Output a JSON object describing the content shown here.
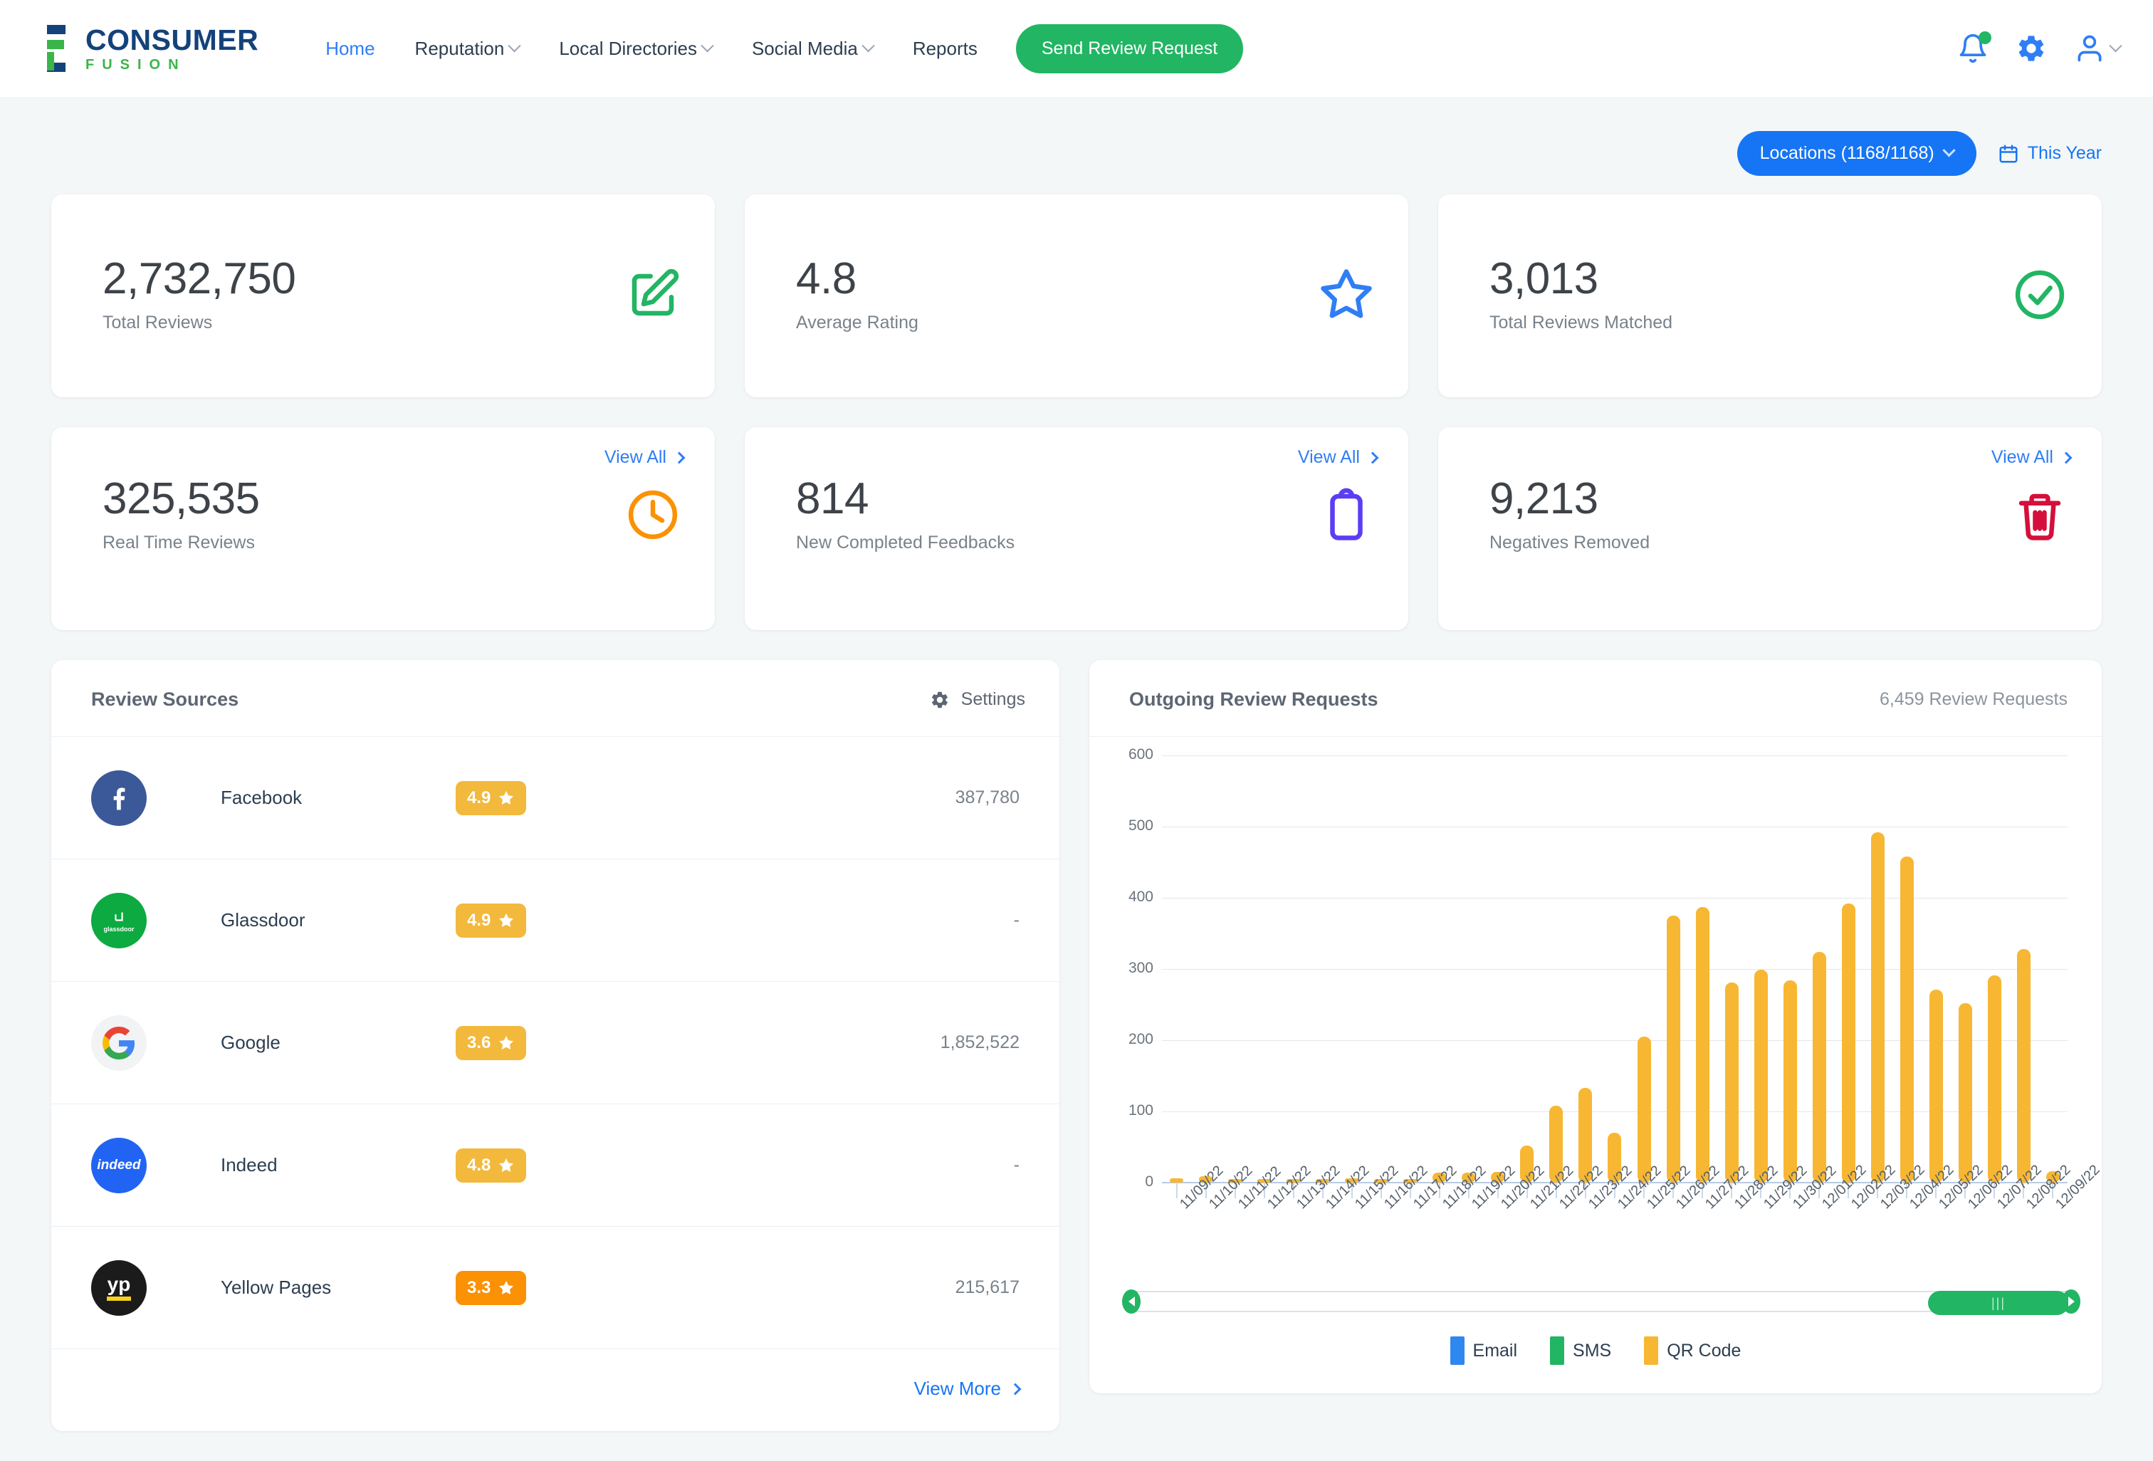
{
  "brand": {
    "name_top": "CONSUMER",
    "name_bottom": "FUSION"
  },
  "nav": {
    "items": [
      {
        "label": "Home",
        "has_caret": false,
        "active": true
      },
      {
        "label": "Reputation",
        "has_caret": true,
        "active": false
      },
      {
        "label": "Local Directories",
        "has_caret": true,
        "active": false
      },
      {
        "label": "Social Media",
        "has_caret": true,
        "active": false
      },
      {
        "label": "Reports",
        "has_caret": false,
        "active": false
      }
    ],
    "cta_label": "Send Review Request"
  },
  "filters": {
    "locations_label": "Locations (1168/1168)",
    "date_label": "This Year"
  },
  "stats_row1": [
    {
      "value": "2,732,750",
      "label": "Total Reviews",
      "icon": "edit-square-icon",
      "color": "#22b563"
    },
    {
      "value": "4.8",
      "label": "Average Rating",
      "icon": "star-outline-icon",
      "color": "#2f7ef5"
    },
    {
      "value": "3,013",
      "label": "Total Reviews Matched",
      "icon": "check-circle-icon",
      "color": "#22b563"
    }
  ],
  "stats_row2": [
    {
      "value": "325,535",
      "label": "Real Time Reviews",
      "icon": "clock-icon",
      "color": "#fb9104",
      "link": "View All"
    },
    {
      "value": "814",
      "label": "New Completed Feedbacks",
      "icon": "clipboard-icon",
      "color": "#5b3df5",
      "link": "View All"
    },
    {
      "value": "9,213",
      "label": "Negatives Removed",
      "icon": "trash-icon",
      "color": "#d50f3c",
      "link": "View All"
    }
  ],
  "review_sources": {
    "title": "Review Sources",
    "settings_label": "Settings",
    "view_more_label": "View More",
    "rows": [
      {
        "name": "Facebook",
        "rating": "4.9",
        "count": "387,780",
        "logo": "facebook-logo",
        "pill_color": "#f2b93c"
      },
      {
        "name": "Glassdoor",
        "rating": "4.9",
        "count": "-",
        "logo": "glassdoor-logo",
        "pill_color": "#f2b93c"
      },
      {
        "name": "Google",
        "rating": "3.6",
        "count": "1,852,522",
        "logo": "google-logo",
        "pill_color": "#f2b93c"
      },
      {
        "name": "Indeed",
        "rating": "4.8",
        "count": "-",
        "logo": "indeed-logo",
        "pill_color": "#f2b93c"
      },
      {
        "name": "Yellow Pages",
        "rating": "3.3",
        "count": "215,617",
        "logo": "yellowpages-logo",
        "pill_color": "#fb9104"
      }
    ]
  },
  "outgoing": {
    "title": "Outgoing Review Requests",
    "summary": "6,459 Review Requests",
    "legend": [
      {
        "label": "Email",
        "color": "#2f88f0"
      },
      {
        "label": "SMS",
        "color": "#22b563"
      },
      {
        "label": "QR Code",
        "color": "#f7b733"
      }
    ]
  },
  "chart_data": {
    "type": "bar",
    "title": "Outgoing Review Requests",
    "xlabel": "",
    "ylabel": "",
    "ylim": [
      0,
      600
    ],
    "yticks": [
      0,
      100,
      200,
      300,
      400,
      500,
      600
    ],
    "grid": true,
    "legend_position": "bottom",
    "categories": [
      "11/09/22",
      "11/10/22",
      "11/11/22",
      "11/12/22",
      "11/13/22",
      "11/14/22",
      "11/15/22",
      "11/16/22",
      "11/17/22",
      "11/18/22",
      "11/19/22",
      "11/20/22",
      "11/21/22",
      "11/22/22",
      "11/23/22",
      "11/24/22",
      "11/25/22",
      "11/26/22",
      "11/27/22",
      "11/28/22",
      "11/29/22",
      "11/30/22",
      "12/01/22",
      "12/02/22",
      "12/03/22",
      "12/04/22",
      "12/05/22",
      "12/06/22",
      "12/07/22",
      "12/08/22",
      "12/09/22"
    ],
    "series": [
      {
        "name": "QR Code",
        "color": "#f7b733",
        "values": [
          6,
          9,
          2,
          3,
          1,
          3,
          6,
          3,
          3,
          14,
          14,
          15,
          52,
          108,
          133,
          70,
          205,
          375,
          387,
          281,
          299,
          284,
          324,
          392,
          492,
          458,
          271,
          252,
          291,
          328,
          16
        ]
      },
      {
        "name": "Email",
        "color": "#2f88f0",
        "values": [
          0,
          0,
          0,
          0,
          0,
          0,
          0,
          0,
          0,
          0,
          0,
          0,
          0,
          0,
          0,
          0,
          0,
          0,
          0,
          0,
          0,
          0,
          0,
          0,
          0,
          0,
          0,
          0,
          0,
          0,
          0
        ]
      },
      {
        "name": "SMS",
        "color": "#22b563",
        "values": [
          0,
          0,
          0,
          0,
          0,
          0,
          0,
          0,
          0,
          0,
          0,
          0,
          0,
          0,
          0,
          0,
          0,
          0,
          0,
          0,
          0,
          0,
          0,
          0,
          0,
          0,
          0,
          0,
          0,
          0,
          0
        ]
      }
    ]
  }
}
